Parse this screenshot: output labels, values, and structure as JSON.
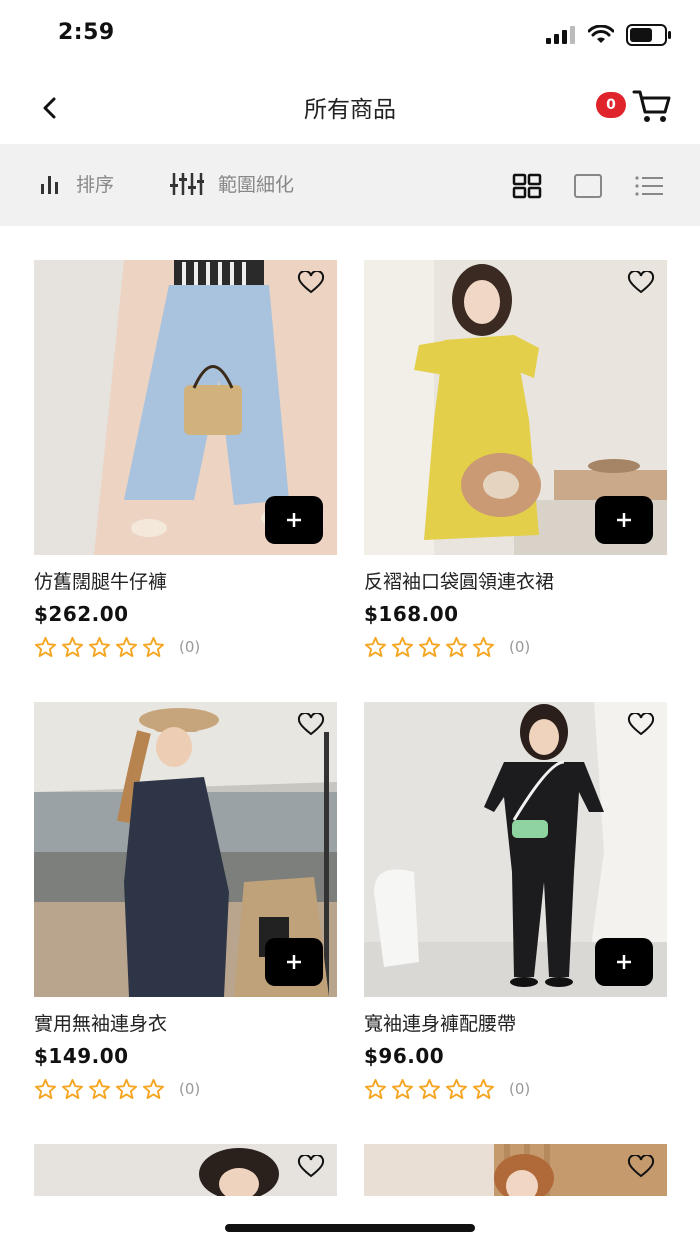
{
  "status_bar": {
    "time": "2:59"
  },
  "nav": {
    "title": "所有商品",
    "cart_count": "0"
  },
  "toolbar": {
    "sort_label": "排序",
    "filter_label": "範圍細化"
  },
  "products": [
    {
      "name": "仿舊闊腿牛仔褲",
      "price": "$262.00",
      "rating_count": "(0)"
    },
    {
      "name": "反褶袖口袋圓領連衣裙",
      "price": "$168.00",
      "rating_count": "(0)"
    },
    {
      "name": "實用無袖連身衣",
      "price": "$149.00",
      "rating_count": "(0)"
    },
    {
      "name": "寬袖連身褲配腰帶",
      "price": "$96.00",
      "rating_count": "(0)"
    }
  ],
  "colors": {
    "badge": "#e0242c",
    "star": "#f5a623",
    "toolbar_bg": "#f1f1f1"
  }
}
